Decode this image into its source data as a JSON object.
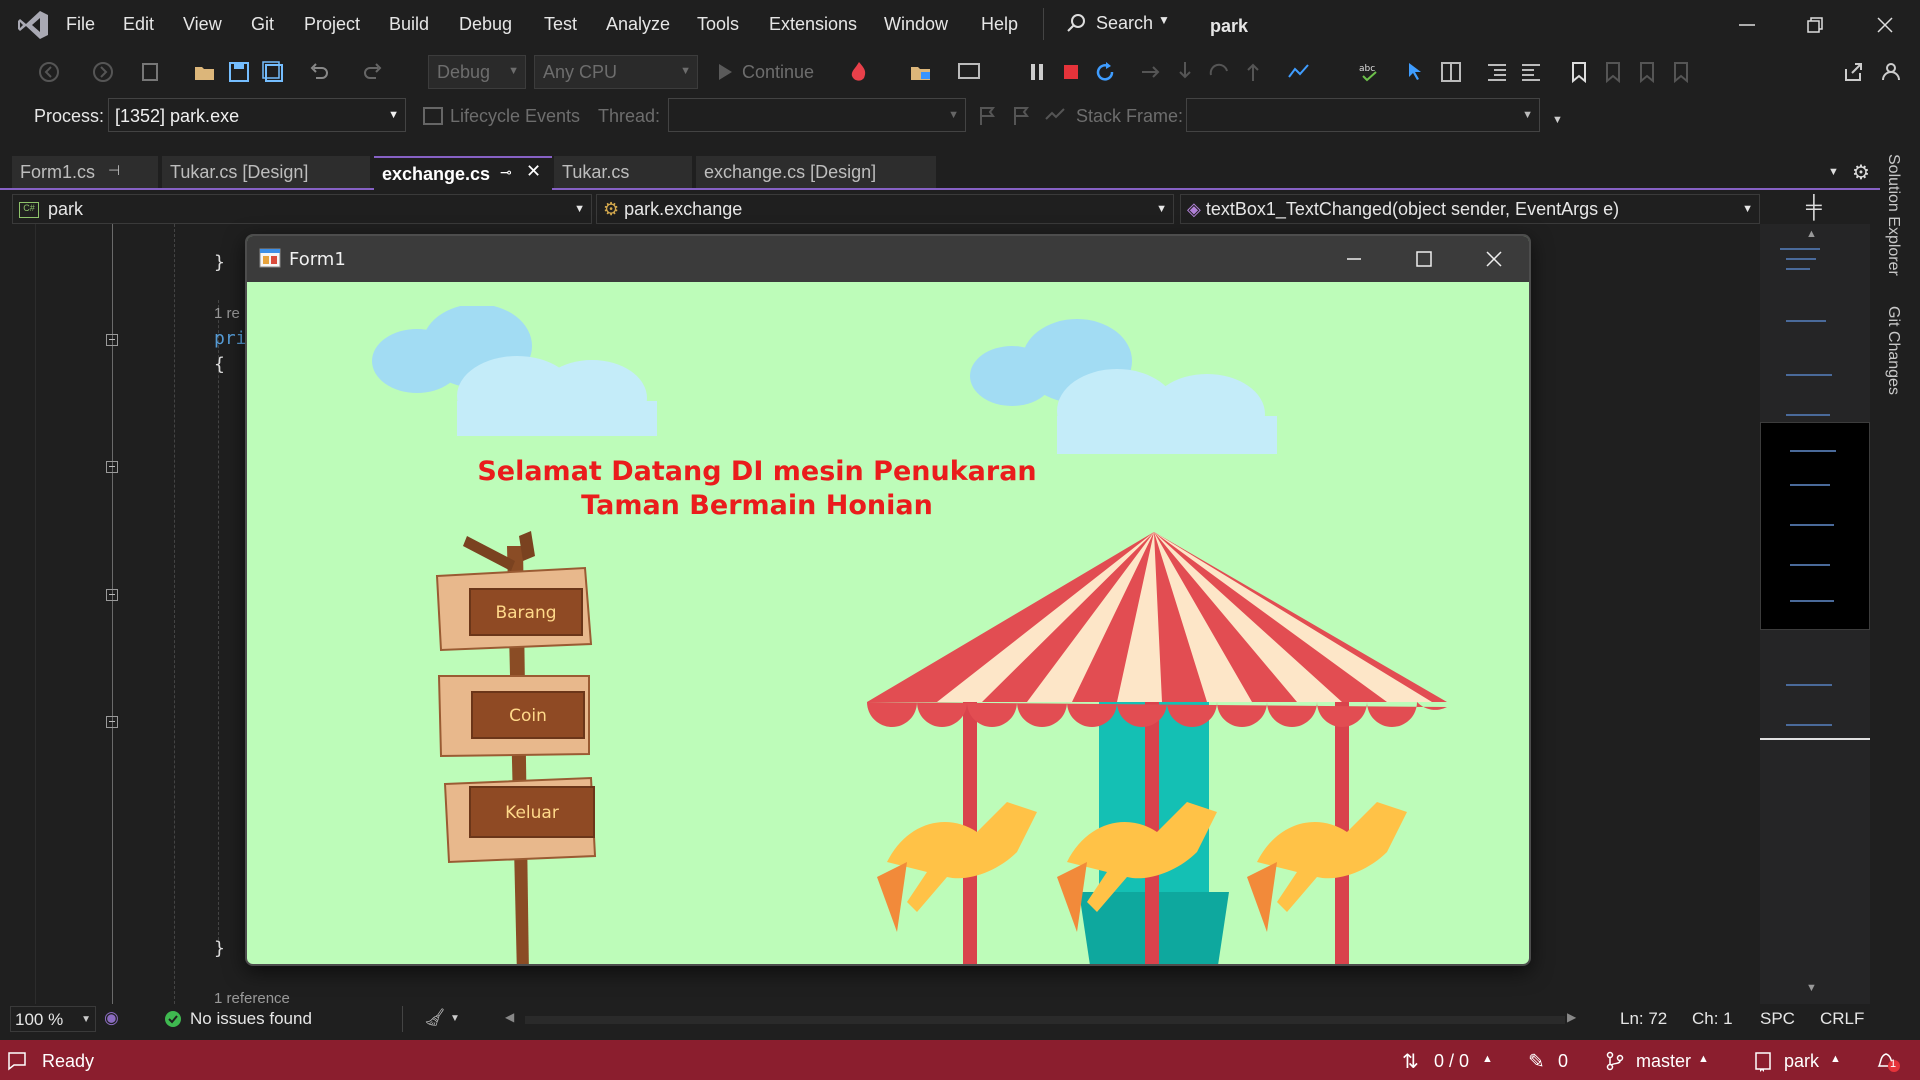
{
  "menubar": {
    "items": [
      "File",
      "Edit",
      "View",
      "Git",
      "Project",
      "Build",
      "Debug",
      "Test",
      "Analyze",
      "Tools",
      "Extensions",
      "Window",
      "Help"
    ],
    "search_label": "Search",
    "solution_name": "park"
  },
  "toolbar": {
    "config": "Debug",
    "platform": "Any CPU",
    "continue_label": "Continue"
  },
  "processbar": {
    "process_label": "Process:",
    "process_value": "[1352] park.exe",
    "lifecycle_label": "Lifecycle Events",
    "thread_label": "Thread:",
    "stack_label": "Stack Frame:"
  },
  "tabs": [
    {
      "label": "Form1.cs",
      "active": false
    },
    {
      "label": "Tukar.cs [Design]",
      "active": false
    },
    {
      "label": "exchange.cs",
      "active": true
    },
    {
      "label": "Tukar.cs",
      "active": false
    },
    {
      "label": "exchange.cs [Design]",
      "active": false
    }
  ],
  "navbar": {
    "project": "park",
    "type": "park.exchange",
    "member": "textBox1_TextChanged(object sender, EventArgs e)"
  },
  "editor": {
    "close_brace_top": "}",
    "codelens_1": "1 re",
    "line_pri": "pri",
    "open_brace": "{",
    "close_brace_bottom": "}",
    "codelens_2": "1 reference"
  },
  "side_tabs": [
    "Solution Explorer",
    "Git Changes"
  ],
  "editorstatus": {
    "zoom": "100 %",
    "issues": "No issues found",
    "line": "Ln: 72",
    "col": "Ch: 1",
    "whitespace": "SPC",
    "line_ending": "CRLF"
  },
  "statusbar": {
    "ready": "Ready",
    "commits": "0 / 0",
    "changes": "0",
    "branch": "master",
    "repo": "park",
    "notifications": "1"
  },
  "form1": {
    "title": "Form1",
    "heading_line1": "Selamat Datang DI mesin Penukaran",
    "heading_line2": "Taman Bermain Honian",
    "buttons": [
      "Barang",
      "Coin",
      "Keluar"
    ]
  },
  "colors": {
    "ide_bg": "#1f1f1f",
    "accent": "#8661c5",
    "statusbar": "#8b1e2e",
    "form_bg": "#bdfcb9",
    "heading": "#ea1c1c",
    "sign_wood": "#8f4a24"
  }
}
